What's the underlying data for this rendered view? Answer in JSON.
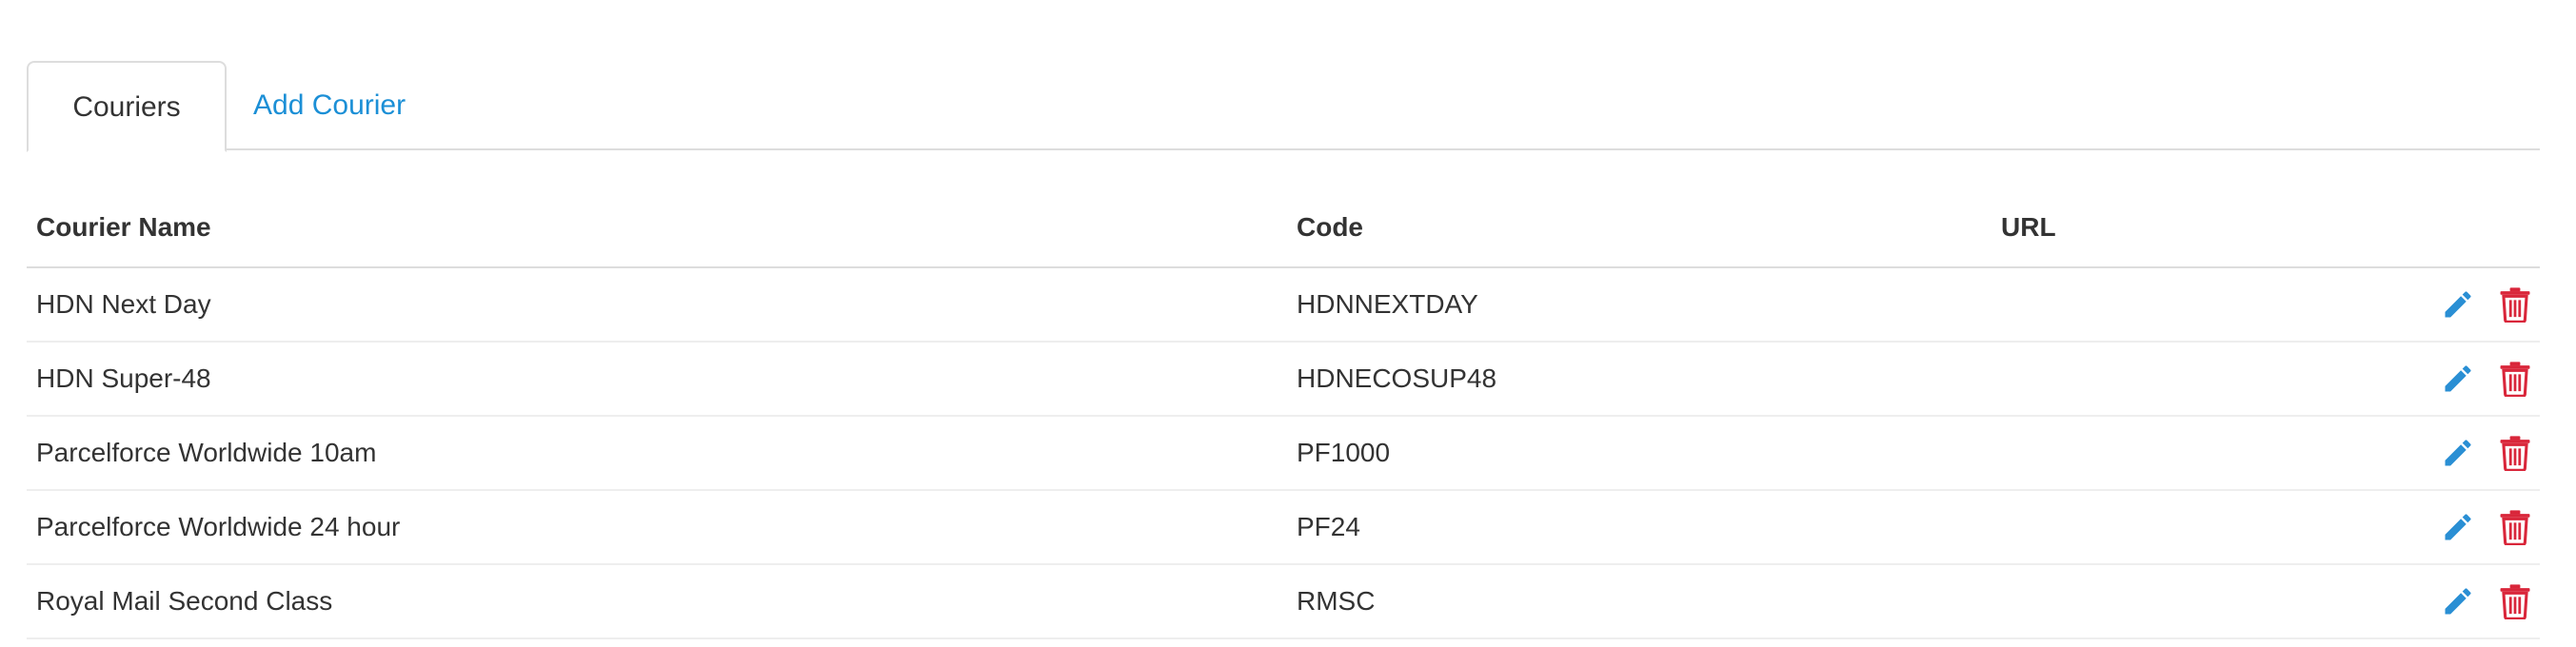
{
  "tabs": [
    {
      "label": "Couriers",
      "active": true
    },
    {
      "label": "Add Courier",
      "active": false
    }
  ],
  "table": {
    "headers": {
      "name": "Courier Name",
      "code": "Code",
      "url": "URL"
    },
    "rows": [
      {
        "name": "HDN Next Day",
        "code": "HDNNEXTDAY",
        "url": ""
      },
      {
        "name": "HDN Super-48",
        "code": "HDNECOSUP48",
        "url": ""
      },
      {
        "name": "Parcelforce Worldwide 10am",
        "code": "PF1000",
        "url": ""
      },
      {
        "name": "Parcelforce Worldwide 24 hour",
        "code": "PF24",
        "url": ""
      },
      {
        "name": "Royal Mail Second Class",
        "code": "RMSC",
        "url": ""
      }
    ]
  },
  "icons": {
    "edit": "pencil-icon",
    "delete": "trash-icon"
  },
  "colors": {
    "link": "#1b8fd6",
    "edit_icon": "#2a8fd4",
    "delete_icon": "#d9263a"
  }
}
